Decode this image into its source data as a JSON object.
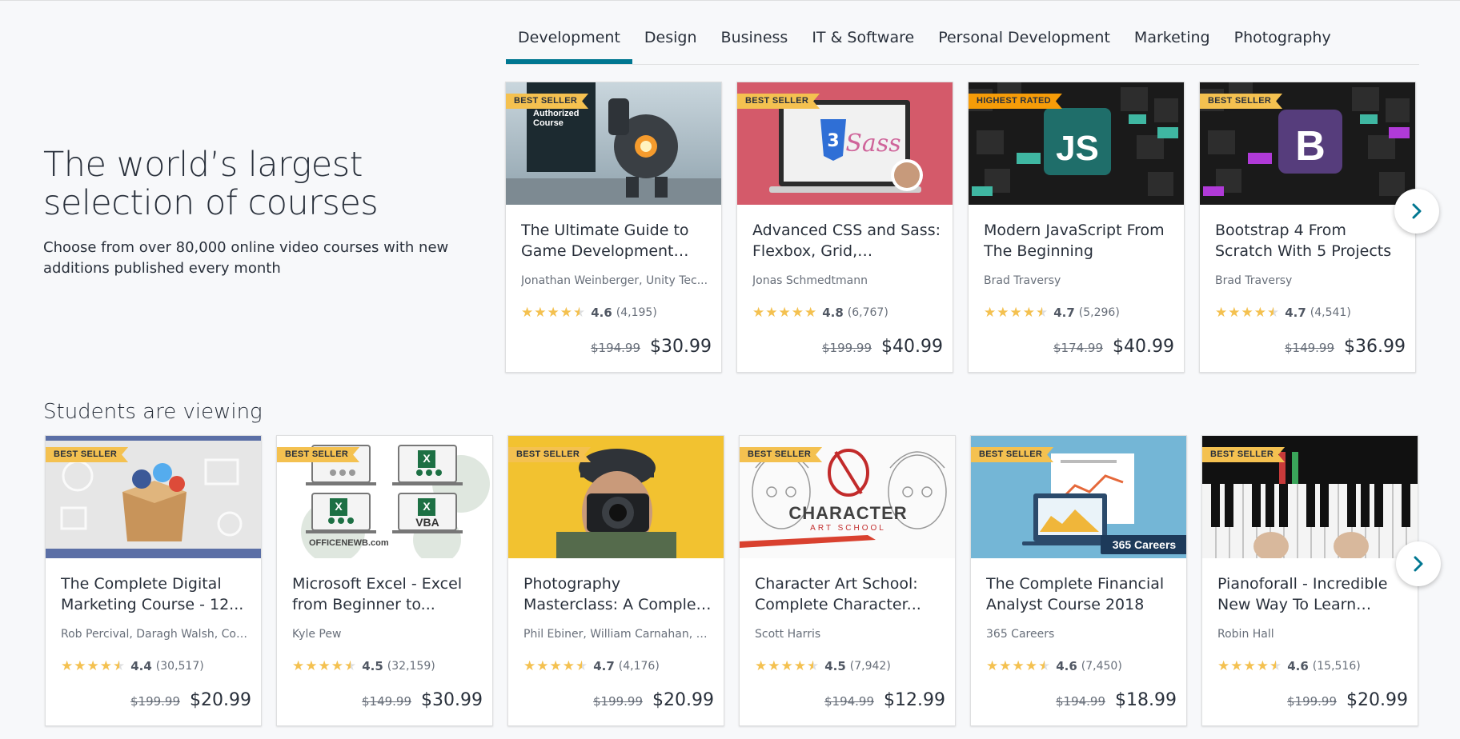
{
  "hero": {
    "title": "The world’s largest selection of courses",
    "subtitle": "Choose from over 80,000 online video courses with new additions published every month"
  },
  "tabs": [
    "Development",
    "Design",
    "Business",
    "IT & Software",
    "Personal Development",
    "Marketing",
    "Photography"
  ],
  "section": {
    "students_viewing": "Students are viewing"
  },
  "thumb_text": {
    "authorized": "Authorized Course",
    "js": "JS",
    "bootstrap": "B",
    "excel": "X",
    "vba": "VBA",
    "officenewb": "OFFICENEWB.com",
    "character": "CHARACTER",
    "art_school": "ART SCHOOL",
    "careers": "365 Careers"
  },
  "courses_row1": [
    {
      "badge": "BEST SELLER",
      "title": "The Ultimate Guide to Game Development wit...",
      "author": "Jonathan Weinberger, Unity Tec...",
      "rating": "4.6",
      "count": "(4,195)",
      "original": "$194.99",
      "price": "$30.99",
      "stars": 4.5
    },
    {
      "badge": "BEST SELLER",
      "title": "Advanced CSS and Sass: Flexbox, Grid, Animation...",
      "author": "Jonas Schmedtmann",
      "rating": "4.8",
      "count": "(6,767)",
      "original": "$199.99",
      "price": "$40.99",
      "stars": 5
    },
    {
      "badge": "HIGHEST RATED",
      "title": "Modern JavaScript From The Beginning",
      "author": "Brad Traversy",
      "rating": "4.7",
      "count": "(5,296)",
      "original": "$174.99",
      "price": "$40.99",
      "stars": 4.5
    },
    {
      "badge": "BEST SELLER",
      "title": "Bootstrap 4 From Scratch With 5 Projects",
      "author": "Brad Traversy",
      "rating": "4.7",
      "count": "(4,541)",
      "original": "$149.99",
      "price": "$36.99",
      "stars": 4.5
    }
  ],
  "courses_row2": [
    {
      "badge": "BEST SELLER",
      "title": "The Complete Digital Marketing Course - 12...",
      "author": "Rob Percival, Daragh Walsh, Cod...",
      "rating": "4.4",
      "count": "(30,517)",
      "original": "$199.99",
      "price": "$20.99",
      "stars": 4.5
    },
    {
      "badge": "BEST SELLER",
      "title": "Microsoft Excel - Excel from Beginner to...",
      "author": "Kyle Pew",
      "rating": "4.5",
      "count": "(32,159)",
      "original": "$149.99",
      "price": "$30.99",
      "stars": 4.5
    },
    {
      "badge": "BEST SELLER",
      "title": "Photography Masterclass: A Complete Guide to...",
      "author": "Phil Ebiner, William Carnahan, Vi...",
      "rating": "4.7",
      "count": "(4,176)",
      "original": "$199.99",
      "price": "$20.99",
      "stars": 4.5
    },
    {
      "badge": "BEST SELLER",
      "title": "Character Art School: Complete Character...",
      "author": "Scott Harris",
      "rating": "4.5",
      "count": "(7,942)",
      "original": "$194.99",
      "price": "$12.99",
      "stars": 4.5
    },
    {
      "badge": "BEST SELLER",
      "title": "The Complete Financial Analyst Course 2018",
      "author": "365 Careers",
      "rating": "4.6",
      "count": "(7,450)",
      "original": "$194.99",
      "price": "$18.99",
      "stars": 4.5
    },
    {
      "badge": "BEST SELLER",
      "title": "Pianoforall - Incredible New Way To Learn Pian...",
      "author": "Robin Hall",
      "rating": "4.6",
      "count": "(15,516)",
      "original": "$199.99",
      "price": "$20.99",
      "stars": 4.5
    }
  ],
  "colors": {
    "tab_active": "#007791",
    "star": "#f4c150",
    "badge": "#f4c150",
    "badge_rated": "#f69c08"
  },
  "icons": {
    "next": "chevron-right-icon",
    "star": "star-icon"
  }
}
